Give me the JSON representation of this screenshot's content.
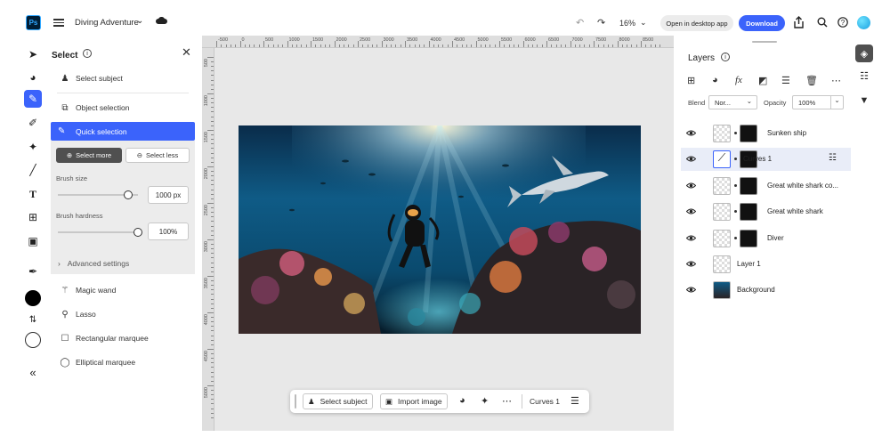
{
  "app": {
    "logo_text": "Ps",
    "doc_title": "Diving Adventure",
    "zoom": "16%",
    "open_desktop_label": "Open in desktop app",
    "download_label": "Download"
  },
  "select_panel": {
    "title": "Select",
    "items_top": [
      {
        "label": "Select subject",
        "icon": "person-icon"
      },
      {
        "label": "Object selection",
        "icon": "object-selection-icon"
      },
      {
        "label": "Quick selection",
        "icon": "quick-selection-icon"
      }
    ],
    "select_more_label": "Select more",
    "select_less_label": "Select less",
    "brush_size_label": "Brush size",
    "brush_size_value": "1000 px",
    "brush_size_fraction": 0.88,
    "brush_hardness_label": "Brush hardness",
    "brush_hardness_value": "100%",
    "brush_hardness_fraction": 1.0,
    "advanced_label": "Advanced settings",
    "items_bottom": [
      {
        "label": "Magic wand",
        "icon": "magic-wand-icon"
      },
      {
        "label": "Lasso",
        "icon": "lasso-icon"
      },
      {
        "label": "Rectangular marquee",
        "icon": "rect-marquee-icon"
      },
      {
        "label": "Elliptical marquee",
        "icon": "ellipse-marquee-icon"
      }
    ]
  },
  "ruler": {
    "top_labels": [
      "-500",
      "0",
      "500",
      "1000",
      "1500",
      "2000",
      "2500",
      "3000",
      "3500",
      "4000",
      "4500",
      "5000",
      "5500",
      "6000",
      "6500",
      "7000",
      "7500",
      "8000",
      "8500"
    ],
    "left_labels": [
      "500",
      "1000",
      "1500",
      "2000",
      "2500",
      "3000",
      "3500",
      "4000",
      "4500",
      "5000"
    ]
  },
  "context_bar": {
    "select_subject_label": "Select subject",
    "import_image_label": "Import image",
    "layer_label": "Curves 1"
  },
  "layers_panel": {
    "title": "Layers",
    "blend_label": "Blend",
    "blend_value": "Nor...",
    "opacity_label": "Opacity",
    "opacity_value": "100%",
    "layers": [
      {
        "name": "Sunken ship",
        "selected": false
      },
      {
        "name": "Curves 1",
        "selected": true
      },
      {
        "name": "Great white shark co...",
        "selected": false
      },
      {
        "name": "Great white shark",
        "selected": false
      },
      {
        "name": "Diver",
        "selected": false
      },
      {
        "name": "Layer 1",
        "selected": false
      },
      {
        "name": "Background",
        "selected": false
      }
    ]
  },
  "colors": {
    "accent": "#3b63fb",
    "foreground_swatch": "#000000",
    "background_swatch": "#ffffff"
  }
}
